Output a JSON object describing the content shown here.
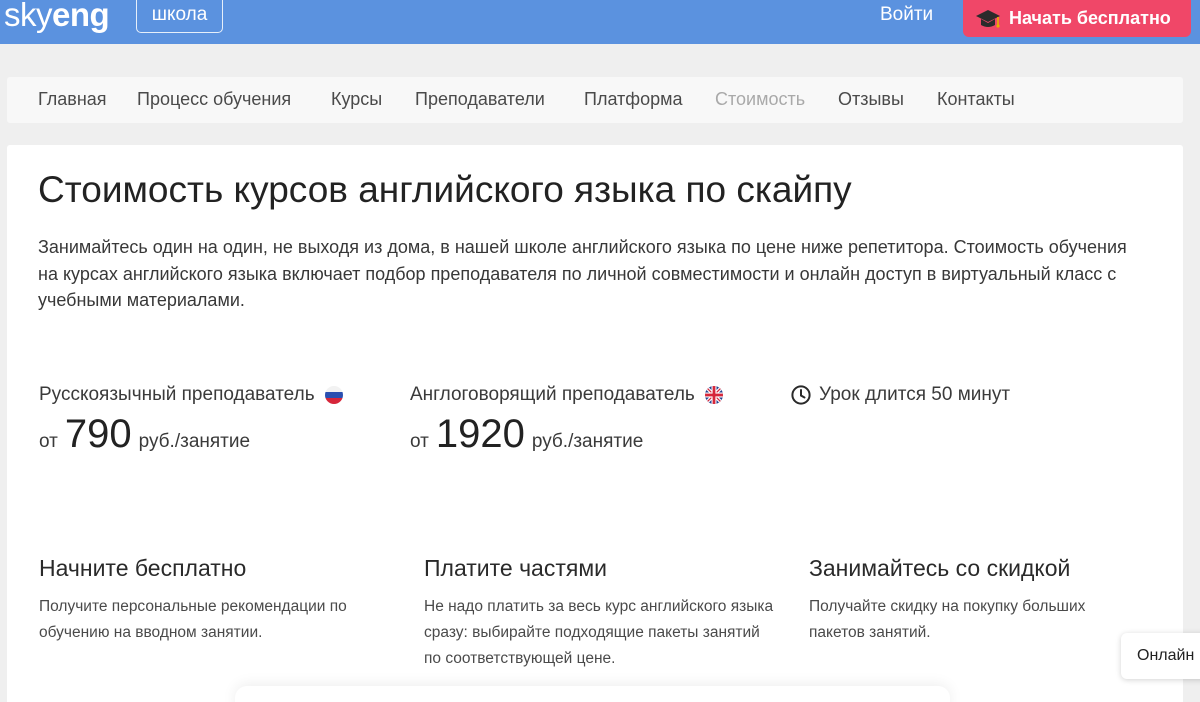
{
  "header": {
    "logo_part1": "sky",
    "logo_part2": "eng",
    "school_badge": "школа",
    "login": "Войти",
    "start_button": "Начать бесплатно",
    "bg_color": "#5b92df",
    "cta_color": "#f04768"
  },
  "nav": {
    "items": [
      {
        "label": "Главная",
        "active": false
      },
      {
        "label": "Процесс обучения",
        "active": false
      },
      {
        "label": "Курсы",
        "active": false
      },
      {
        "label": "Преподаватели",
        "active": false
      },
      {
        "label": "Платформа",
        "active": false
      },
      {
        "label": "Стоимость",
        "active": true
      },
      {
        "label": "Отзывы",
        "active": false
      },
      {
        "label": "Контакты",
        "active": false
      }
    ]
  },
  "main": {
    "title": "Стоимость курсов английского языка по скайпу",
    "lead": "Занимайтесь один на один, не выходя из дома, в нашей школе английского языка по цене ниже репетитора. Стоимость обучения на курсах английского языка включает подбор преподавателя по личной совместимости и онлайн доступ в виртуальный класс с учебными материалами.",
    "prices": [
      {
        "label": "Русскоязычный преподаватель",
        "flag_icon": "russia-flag-icon",
        "prefix": "от",
        "amount": "790",
        "unit": "руб./занятие"
      },
      {
        "label": "Англоговорящий преподаватель",
        "flag_icon": "uk-flag-icon",
        "prefix": "от",
        "amount": "1920",
        "unit": "руб./занятие"
      }
    ],
    "duration": {
      "icon": "clock-icon",
      "label": "Урок длится 50 минут"
    },
    "features": [
      {
        "title": "Начните бесплатно",
        "text": "Получите персональные рекомендации по обучению на вводном занятии."
      },
      {
        "title": "Платите частями",
        "text": "Не надо платить за весь курс английского языка сразу: выбирайте подходящие пакеты занятий по соответствующей цене."
      },
      {
        "title": "Занимайтесь со скидкой",
        "text": "Получайте скидку на покупку больших пакетов занятий."
      }
    ]
  },
  "online_chat": "Онлайн"
}
